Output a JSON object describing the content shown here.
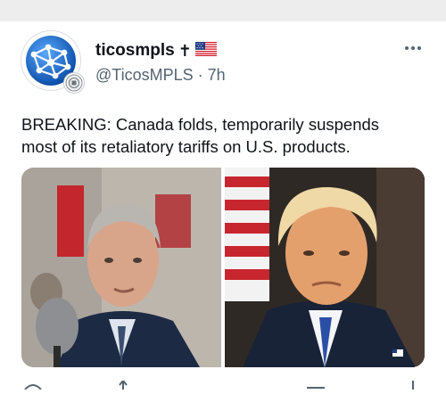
{
  "post": {
    "author": {
      "display_name": "ticosmpls",
      "cross_glyph": "✝",
      "flag_icon": "us-flag-icon",
      "handle": "@TicosMPLS",
      "separator": "·",
      "time": "7h",
      "avatar_icon": "globe-network-icon",
      "badge_icon": "affiliate-badge-icon"
    },
    "more_icon": "more-options-icon",
    "text_line_1": "BREAKING: Canada folds, temporarily suspends",
    "text_line_2": "most of its retaliatory tariffs on U.S. products.",
    "media": [
      {
        "id": "left-photo",
        "alt_icon": "portrait-man-grey-hair-microphone"
      },
      {
        "id": "right-photo",
        "alt_icon": "portrait-man-blond-hair-flag-background"
      }
    ],
    "actions": [
      "reply-icon",
      "repost-icon",
      "like-icon",
      "share-icon"
    ]
  },
  "colors": {
    "text_primary": "#0f1419",
    "text_secondary": "#536471",
    "top_band": "#ededed",
    "avatar_blue": "#1f6fd1"
  }
}
